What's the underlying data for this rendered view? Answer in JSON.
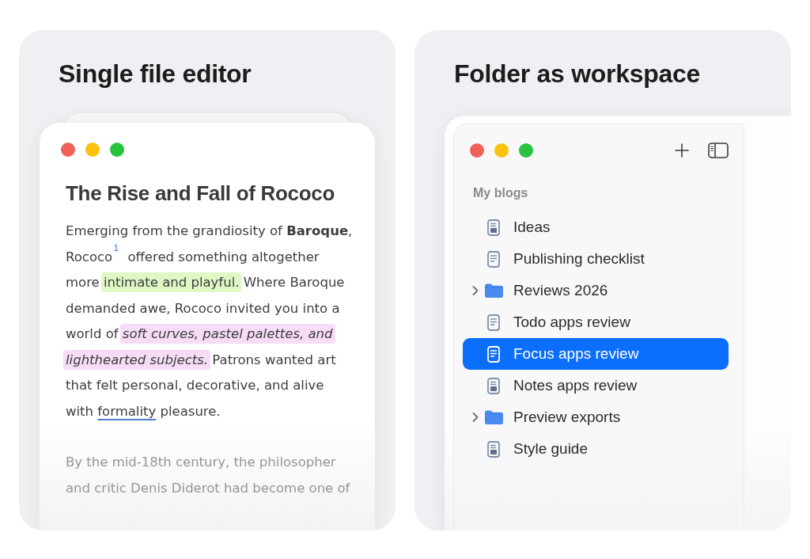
{
  "editor_panel": {
    "title": "Single file editor",
    "document": {
      "heading": "The Rise and Fall of Rococo",
      "paragraphs": [
        {
          "dimmed": false,
          "segments": [
            {
              "kind": "text",
              "text": "Emerging from the grandiosity of **Baroque**, Rococo$^{1}$ offered something altogether more "
            },
            {
              "kind": "highlight",
              "color": "#dff7c4",
              "text": "intimate and playful."
            },
            {
              "kind": "text",
              "text": " Where Baroque demanded awe, Rococo invited you into a world of "
            },
            {
              "kind": "highlight",
              "color": "#f6dcf7",
              "text": "*soft curves, pastel palettes, and lighthearted subjects.*"
            },
            {
              "kind": "text",
              "text": " Patrons wanted art that felt personal, decorative, and alive with "
            },
            {
              "kind": "link",
              "text": "formality"
            },
            {
              "kind": "text",
              "text": " pleasure."
            }
          ]
        },
        {
          "dimmed": true,
          "segments": [
            {
              "kind": "text",
              "text": "By the mid-18th century, the philosopher and critic Denis Diderot had become one of"
            }
          ]
        }
      ]
    }
  },
  "workspace_panel": {
    "title": "Folder as workspace",
    "sidebar": {
      "section_label": "My blogs",
      "items": [
        {
          "kind": "preview",
          "label": "Ideas",
          "selected": false
        },
        {
          "kind": "document",
          "label": "Publishing checklist",
          "selected": false
        },
        {
          "kind": "folder",
          "label": "Reviews 2026",
          "selected": false,
          "expanded": false
        },
        {
          "kind": "document",
          "label": "Todo apps review",
          "selected": false
        },
        {
          "kind": "document",
          "label": "Focus apps review",
          "selected": true
        },
        {
          "kind": "preview",
          "label": "Notes apps review",
          "selected": false
        },
        {
          "kind": "folder",
          "label": "Preview exports",
          "selected": false,
          "expanded": false
        },
        {
          "kind": "preview",
          "label": "Style guide",
          "selected": false
        }
      ]
    }
  }
}
